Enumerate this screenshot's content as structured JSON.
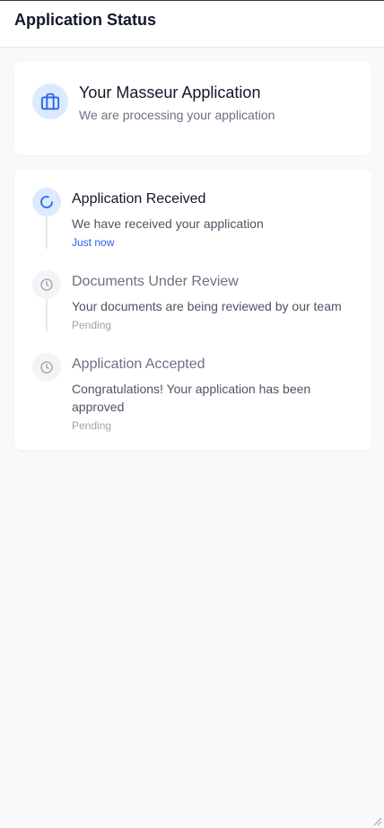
{
  "header": {
    "title": "Application Status"
  },
  "application": {
    "icon": "briefcase-icon",
    "title": "Your Masseur Application",
    "subtitle": "We are processing your application"
  },
  "steps": [
    {
      "icon": "spinner-icon",
      "state": "active",
      "title": "Application Received",
      "description": "We have received your application",
      "time": "Just now"
    },
    {
      "icon": "clock-icon",
      "state": "pending",
      "title": "Documents Under Review",
      "description": "Your documents are being reviewed by our team",
      "time": "Pending"
    },
    {
      "icon": "clock-icon",
      "state": "pending",
      "title": "Application Accepted",
      "description": "Congratulations! Your application has been approved",
      "time": "Pending"
    }
  ],
  "colors": {
    "accent": "#2563eb",
    "accent_bg": "#dbeafe",
    "pending_bg": "#f3f4f6",
    "muted_text": "#6b7280"
  }
}
